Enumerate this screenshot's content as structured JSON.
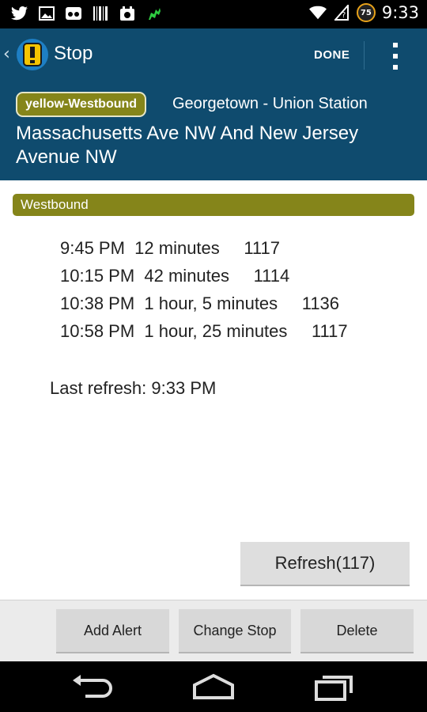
{
  "status_bar": {
    "time": "9:33",
    "battery_level": "75",
    "left_icons": [
      "twitter-icon",
      "image-icon",
      "voicemail-icon",
      "barcode-icon",
      "calendar-icon",
      "android-icon"
    ],
    "right_icons": [
      "wifi-icon",
      "no-signal-icon",
      "battery-icon"
    ]
  },
  "action_bar": {
    "title": "Stop",
    "done_label": "DONE"
  },
  "header": {
    "route_badge": "yellow-Westbound",
    "destination": "Georgetown - Union Station",
    "stop_name": "Massachusetts Ave NW And New Jersey Avenue NW"
  },
  "direction": {
    "label": "Westbound"
  },
  "predictions": [
    {
      "time": "9:45 PM",
      "eta": "12 minutes",
      "vehicle": "1117",
      "text": "9:45 PM  12 minutes     1117"
    },
    {
      "time": "10:15 PM",
      "eta": "42 minutes",
      "vehicle": "1114",
      "text": "10:15 PM  42 minutes     1114"
    },
    {
      "time": "10:38 PM",
      "eta": "1 hour, 5 minutes",
      "vehicle": "1136",
      "text": "10:38 PM  1 hour, 5 minutes     1136"
    },
    {
      "time": "10:58 PM",
      "eta": "1 hour, 25 minutes",
      "vehicle": "1117",
      "text": "10:58 PM  1 hour, 25 minutes     1117"
    }
  ],
  "last_refresh": "Last refresh: 9:33 PM",
  "buttons": {
    "refresh": "Refresh(117)",
    "add_alert": "Add Alert",
    "change_stop": "Change Stop",
    "delete": "Delete"
  },
  "colors": {
    "action_bar": "#0f4b6e",
    "route_olive": "#85851a",
    "app_icon_yellow": "#f5c400"
  }
}
